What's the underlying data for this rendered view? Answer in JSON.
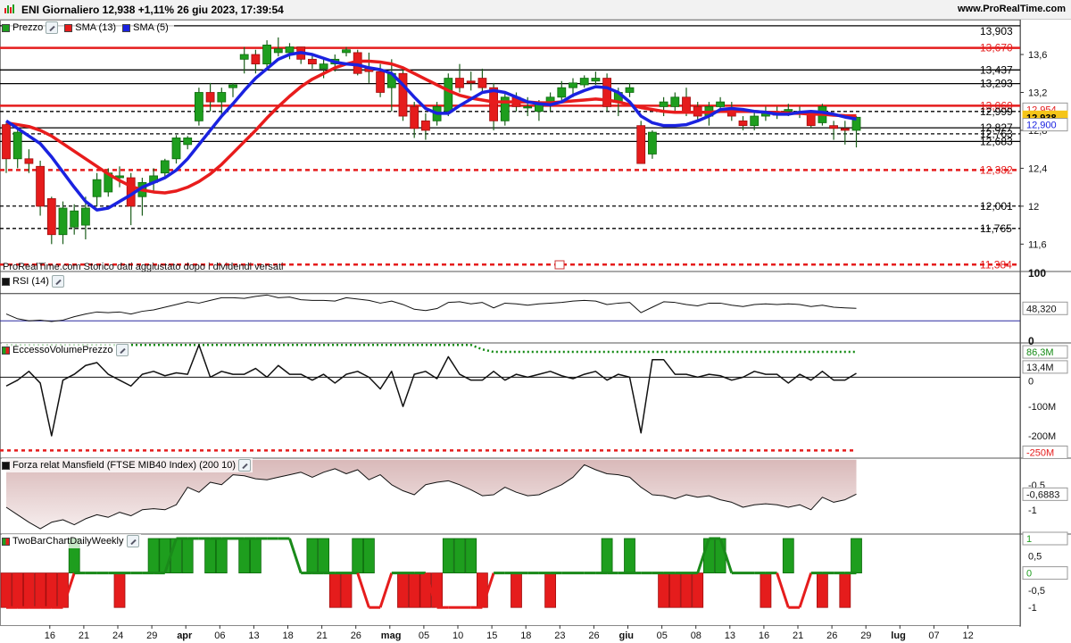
{
  "header": {
    "title": "ENI Giornaliero 12,938 +1,11% 26 giu 2023, 17:39:54",
    "site": "www.ProRealTime.com"
  },
  "note": "ProRealTime.com Storico dati aggiustato dopo i dividendi versati",
  "colors": {
    "up": "#1e9e1e",
    "down": "#e51c1c",
    "sma13": "#e81c1c",
    "sma5": "#1a22e0",
    "resistance_red": "#e51c1c",
    "volume_dotted": "#138a13"
  },
  "price_panel": {
    "label": "Prezzo",
    "sma13_label": "SMA (13)",
    "sma5_label": "SMA (5)",
    "axis_ticks": [
      "13,6",
      "13,2",
      "12,8",
      "12,4",
      "12",
      "11,6"
    ],
    "current_price": "12,938",
    "sma_value": "12,900",
    "sma13_value": "12,954",
    "levels": [
      {
        "value": 13.903,
        "label": "13,903",
        "style": "solid",
        "color": "#000000"
      },
      {
        "value": 13.67,
        "label": "13,670",
        "style": "solid",
        "color": "#e51c1c"
      },
      {
        "value": 13.437,
        "label": "13,437",
        "style": "solid",
        "color": "#000000"
      },
      {
        "value": 13.293,
        "label": "13,293",
        "style": "solid",
        "color": "#000000"
      },
      {
        "value": 13.06,
        "label": "13,060",
        "style": "solid",
        "color": "#e51c1c"
      },
      {
        "value": 12.999,
        "label": "12,999",
        "style": "dashed",
        "color": "#000000"
      },
      {
        "value": 12.827,
        "label": "12,827",
        "style": "solid",
        "color": "#000000"
      },
      {
        "value": 12.763,
        "label": "12,763",
        "style": "dashed",
        "color": "#000000"
      },
      {
        "value": 12.683,
        "label": "12,683",
        "style": "solid",
        "color": "#000000"
      },
      {
        "value": 12.382,
        "label": "12,382",
        "style": "dashed",
        "color": "#e51c1c"
      },
      {
        "value": 12.001,
        "label": "12,001",
        "style": "dashed",
        "color": "#000000"
      },
      {
        "value": 11.765,
        "label": "11,765",
        "style": "dashed",
        "color": "#000000"
      },
      {
        "value": 11.384,
        "label": "11,384",
        "style": "dashed",
        "color": "#e51c1c"
      }
    ]
  },
  "rsi_panel": {
    "label": "RSI (14)",
    "ticks": [
      "100",
      "0"
    ],
    "value": "48,320"
  },
  "volume_panel": {
    "label": "EccessoVolumePrezzo",
    "ticks": [
      "-100M",
      "-200M"
    ],
    "value_upper": "86,3M",
    "value_current": "13,4M",
    "value_zero": "0",
    "value_lower": "-250M"
  },
  "mansfield_panel": {
    "label": "Forza relat Mansfield (FTSE MIB40 Index) (200 10)",
    "ticks": [
      "-0,5",
      "-1"
    ],
    "value": "-0,6883"
  },
  "twobar_panel": {
    "label": "TwoBarChartDailyWeekly",
    "ticks": [
      "0,5",
      "-0,5",
      "-1"
    ],
    "value_top": "1",
    "value_mid": "0"
  },
  "x_axis": {
    "labels": [
      {
        "i": 4,
        "text": "16"
      },
      {
        "i": 7,
        "text": "21"
      },
      {
        "i": 10,
        "text": "24"
      },
      {
        "i": 13,
        "text": "29"
      },
      {
        "i": 16,
        "text": "apr"
      },
      {
        "i": 19,
        "text": "06"
      },
      {
        "i": 22,
        "text": "13"
      },
      {
        "i": 25,
        "text": "18"
      },
      {
        "i": 28,
        "text": "21"
      },
      {
        "i": 31,
        "text": "26"
      },
      {
        "i": 34,
        "text": "mag"
      },
      {
        "i": 37,
        "text": "05"
      },
      {
        "i": 40,
        "text": "10"
      },
      {
        "i": 43,
        "text": "15"
      },
      {
        "i": 46,
        "text": "18"
      },
      {
        "i": 49,
        "text": "23"
      },
      {
        "i": 52,
        "text": "26"
      },
      {
        "i": 55,
        "text": "giu"
      },
      {
        "i": 58,
        "text": "05"
      },
      {
        "i": 61,
        "text": "08"
      },
      {
        "i": 64,
        "text": "13"
      },
      {
        "i": 67,
        "text": "16"
      },
      {
        "i": 70,
        "text": "21"
      },
      {
        "i": 73,
        "text": "26"
      },
      {
        "i": 76,
        "text": "29"
      },
      {
        "i": 79,
        "text": "lug"
      },
      {
        "i": 82,
        "text": "07"
      },
      {
        "i": 85,
        "text": "12"
      }
    ]
  },
  "chart_data": {
    "type": "candlestick",
    "candles_ohlc": [
      [
        12.86,
        12.88,
        12.35,
        12.5
      ],
      [
        12.5,
        12.82,
        12.4,
        12.78
      ],
      [
        12.5,
        12.6,
        12.35,
        12.45
      ],
      [
        12.42,
        12.48,
        11.9,
        12.0
      ],
      [
        12.08,
        12.1,
        11.6,
        11.7
      ],
      [
        11.7,
        12.05,
        11.6,
        11.98
      ],
      [
        11.78,
        12.02,
        11.7,
        11.95
      ],
      [
        11.8,
        12.1,
        11.65,
        11.98
      ],
      [
        12.1,
        12.35,
        12.0,
        12.28
      ],
      [
        12.15,
        12.4,
        12.1,
        12.35
      ],
      [
        12.3,
        12.42,
        12.2,
        12.32
      ],
      [
        12.3,
        12.35,
        11.8,
        12.0
      ],
      [
        12.1,
        12.3,
        11.9,
        12.25
      ],
      [
        12.25,
        12.4,
        12.15,
        12.32
      ],
      [
        12.35,
        12.5,
        12.3,
        12.48
      ],
      [
        12.5,
        12.75,
        12.45,
        12.72
      ],
      [
        12.65,
        12.74,
        12.6,
        12.72
      ],
      [
        12.9,
        13.25,
        12.85,
        13.2
      ],
      [
        13.2,
        13.3,
        13.0,
        13.1
      ],
      [
        13.1,
        13.25,
        12.95,
        13.2
      ],
      [
        13.25,
        13.3,
        13.15,
        13.28
      ],
      [
        13.55,
        13.68,
        13.4,
        13.6
      ],
      [
        13.6,
        13.65,
        13.4,
        13.5
      ],
      [
        13.5,
        13.75,
        13.45,
        13.7
      ],
      [
        13.62,
        13.78,
        13.58,
        13.66
      ],
      [
        13.62,
        13.72,
        13.55,
        13.68
      ],
      [
        13.68,
        13.68,
        13.5,
        13.55
      ],
      [
        13.55,
        13.6,
        13.45,
        13.5
      ],
      [
        13.45,
        13.55,
        13.35,
        13.5
      ],
      [
        13.5,
        13.6,
        13.42,
        13.55
      ],
      [
        13.62,
        13.68,
        13.58,
        13.65
      ],
      [
        13.62,
        13.65,
        13.38,
        13.4
      ],
      [
        13.45,
        13.62,
        13.3,
        13.42
      ],
      [
        13.42,
        13.5,
        13.15,
        13.2
      ],
      [
        13.25,
        13.55,
        13.0,
        13.4
      ],
      [
        13.4,
        13.45,
        12.9,
        12.95
      ],
      [
        13.05,
        13.1,
        12.72,
        12.82
      ],
      [
        12.9,
        12.98,
        12.7,
        12.8
      ],
      [
        12.9,
        13.1,
        12.85,
        13.05
      ],
      [
        13.0,
        13.4,
        12.95,
        13.35
      ],
      [
        13.35,
        13.5,
        13.2,
        13.25
      ],
      [
        13.32,
        13.42,
        13.22,
        13.3
      ],
      [
        13.35,
        13.45,
        13.2,
        13.25
      ],
      [
        13.25,
        13.3,
        12.8,
        12.9
      ],
      [
        12.9,
        13.2,
        12.85,
        13.15
      ],
      [
        13.15,
        13.2,
        13.0,
        13.05
      ],
      [
        13.05,
        13.15,
        12.95,
        13.05
      ],
      [
        13.0,
        13.12,
        12.9,
        13.1
      ],
      [
        13.1,
        13.2,
        13.0,
        13.15
      ],
      [
        13.15,
        13.32,
        13.1,
        13.25
      ],
      [
        13.25,
        13.35,
        13.15,
        13.3
      ],
      [
        13.28,
        13.38,
        13.25,
        13.35
      ],
      [
        13.32,
        13.42,
        13.28,
        13.35
      ],
      [
        13.35,
        13.4,
        13.0,
        13.05
      ],
      [
        13.1,
        13.25,
        12.95,
        13.2
      ],
      [
        13.2,
        13.3,
        13.15,
        13.25
      ],
      [
        12.85,
        12.9,
        12.45,
        12.45
      ],
      [
        12.55,
        12.8,
        12.5,
        12.78
      ],
      [
        13.05,
        13.15,
        12.95,
        13.1
      ],
      [
        13.05,
        13.2,
        13.0,
        13.15
      ],
      [
        13.15,
        13.25,
        12.95,
        13.0
      ],
      [
        13.05,
        13.1,
        12.9,
        12.95
      ],
      [
        12.95,
        13.1,
        12.85,
        13.05
      ],
      [
        13.05,
        13.15,
        13.0,
        13.1
      ],
      [
        13.0,
        13.1,
        12.9,
        12.95
      ],
      [
        12.9,
        12.95,
        12.8,
        12.85
      ],
      [
        12.85,
        13.0,
        12.8,
        12.95
      ],
      [
        12.95,
        13.05,
        12.9,
        13.0
      ],
      [
        12.98,
        13.05,
        12.92,
        12.96
      ],
      [
        13.0,
        13.08,
        12.95,
        13.02
      ],
      [
        12.98,
        13.05,
        12.93,
        13.0
      ],
      [
        12.98,
        13.0,
        12.82,
        12.85
      ],
      [
        12.88,
        13.08,
        12.85,
        13.05
      ],
      [
        12.85,
        12.9,
        12.7,
        12.82
      ],
      [
        12.82,
        12.9,
        12.65,
        12.8
      ],
      [
        12.8,
        12.95,
        12.62,
        12.938
      ]
    ],
    "sma5": [
      12.9,
      12.82,
      12.74,
      12.66,
      12.52,
      12.36,
      12.2,
      12.05,
      11.96,
      11.98,
      12.05,
      12.12,
      12.2,
      12.25,
      12.3,
      12.38,
      12.5,
      12.65,
      12.8,
      12.95,
      13.08,
      13.22,
      13.35,
      13.45,
      13.55,
      13.6,
      13.62,
      13.6,
      13.56,
      13.52,
      13.5,
      13.49,
      13.46,
      13.44,
      13.4,
      13.28,
      13.15,
      13.03,
      12.98,
      12.98,
      13.06,
      13.13,
      13.2,
      13.22,
      13.2,
      13.15,
      13.1,
      13.08,
      13.07,
      13.1,
      13.17,
      13.22,
      13.26,
      13.25,
      13.2,
      13.1,
      12.95,
      12.88,
      12.85,
      12.85,
      12.86,
      12.9,
      12.95,
      13.02,
      13.03,
      13.02,
      13.0,
      12.99,
      12.97,
      12.97,
      12.99,
      13.0,
      12.99,
      12.97,
      12.94,
      12.92
    ],
    "sma13": [
      12.88,
      12.86,
      12.84,
      12.8,
      12.74,
      12.66,
      12.58,
      12.5,
      12.42,
      12.34,
      12.27,
      12.21,
      12.17,
      12.15,
      12.14,
      12.16,
      12.2,
      12.26,
      12.34,
      12.44,
      12.56,
      12.68,
      12.8,
      12.93,
      13.05,
      13.16,
      13.26,
      13.34,
      13.4,
      13.46,
      13.5,
      13.53,
      13.53,
      13.52,
      13.5,
      13.46,
      13.4,
      13.34,
      13.28,
      13.22,
      13.17,
      13.14,
      13.12,
      13.1,
      13.1,
      13.1,
      13.1,
      13.09,
      13.09,
      13.1,
      13.11,
      13.12,
      13.13,
      13.12,
      13.1,
      13.07,
      13.04,
      13.02,
      13.0,
      12.99,
      12.99,
      12.99,
      12.99,
      13.0,
      13.0,
      13.0,
      13.0,
      12.99,
      12.99,
      12.98,
      12.98,
      12.97,
      12.97,
      12.96,
      12.955,
      12.954
    ],
    "rsi": [
      40,
      33,
      30,
      31,
      29,
      31,
      36,
      40,
      43,
      42,
      43,
      40,
      44,
      46,
      50,
      54,
      58,
      56,
      60,
      64,
      64,
      63,
      66,
      68,
      64,
      65,
      61,
      60,
      60,
      59,
      64,
      62,
      60,
      56,
      59,
      54,
      47,
      45,
      48,
      57,
      58,
      55,
      57,
      49,
      56,
      55,
      53,
      55,
      56,
      57,
      59,
      60,
      59,
      54,
      56,
      57,
      42,
      50,
      58,
      57,
      54,
      52,
      56,
      56,
      53,
      51,
      54,
      55,
      54,
      55,
      54,
      51,
      53,
      50,
      49,
      48.32
    ],
    "excess_volume_m": [
      -30,
      -10,
      20,
      -20,
      -200,
      -10,
      10,
      40,
      50,
      10,
      -10,
      -30,
      10,
      20,
      5,
      15,
      10,
      110,
      0,
      20,
      10,
      10,
      30,
      0,
      40,
      10,
      10,
      -10,
      10,
      -20,
      10,
      20,
      0,
      -40,
      20,
      -100,
      10,
      20,
      -5,
      70,
      10,
      -10,
      -10,
      20,
      -10,
      10,
      0,
      10,
      20,
      5,
      -5,
      10,
      20,
      -10,
      10,
      0,
      -190,
      60,
      60,
      10,
      10,
      0,
      10,
      5,
      -10,
      0,
      20,
      10,
      10,
      -20,
      10,
      -10,
      20,
      -10,
      -10,
      13.4
    ],
    "excess_volume_upper_m": [
      86.3
    ],
    "mansfield": [
      -0.95,
      -1.1,
      -1.25,
      -1.38,
      -1.25,
      -1.2,
      -1.3,
      -1.18,
      -1.1,
      -1.15,
      -1.05,
      -1.12,
      -1.0,
      -0.98,
      -1.0,
      -0.9,
      -0.55,
      -0.65,
      -0.45,
      -0.5,
      -0.3,
      -0.32,
      -0.38,
      -0.4,
      -0.35,
      -0.3,
      -0.25,
      -0.35,
      -0.25,
      -0.18,
      -0.28,
      -0.2,
      -0.4,
      -0.3,
      -0.5,
      -0.62,
      -0.7,
      -0.5,
      -0.45,
      -0.42,
      -0.5,
      -0.6,
      -0.72,
      -0.7,
      -0.55,
      -0.65,
      -0.72,
      -0.7,
      -0.6,
      -0.5,
      -0.35,
      -0.1,
      -0.2,
      -0.28,
      -0.3,
      -0.35,
      -0.55,
      -0.7,
      -0.72,
      -0.78,
      -0.7,
      -0.75,
      -0.72,
      -0.8,
      -0.85,
      -0.95,
      -0.9,
      -0.88,
      -0.9,
      -0.95,
      -0.9,
      -1.0,
      -0.75,
      -0.85,
      -0.8,
      -0.6883
    ],
    "twobar_signal": [
      -1,
      -1,
      -1,
      -1,
      -1,
      -1,
      0,
      0,
      0,
      0,
      0,
      0,
      0,
      0,
      0,
      1,
      1,
      1,
      1,
      1,
      1,
      1,
      1,
      1,
      1,
      1,
      0,
      0,
      0,
      0,
      0,
      0,
      -1,
      -1,
      0,
      0,
      0,
      0,
      -1,
      -1,
      -1,
      -1,
      -1,
      0,
      0,
      0,
      0,
      0,
      0,
      0,
      0,
      0,
      0,
      0,
      0,
      0,
      0,
      0,
      0,
      0,
      0,
      0,
      1,
      1,
      0,
      0,
      0,
      0,
      0,
      -1,
      -1,
      0,
      0,
      0,
      0,
      0,
      0,
      0,
      0,
      0,
      0,
      0,
      0,
      0,
      0,
      0,
      0
    ],
    "twobar_bars": [
      -1,
      -1,
      -1,
      -1,
      -1,
      -1,
      1,
      0,
      0,
      0,
      -1,
      0,
      0,
      1,
      1,
      1,
      1,
      0,
      1,
      1,
      0,
      1,
      1,
      0,
      0,
      0,
      0,
      1,
      1,
      -1,
      -1,
      1,
      1,
      0,
      0,
      -1,
      -1,
      -1,
      -1,
      1,
      1,
      1,
      -1,
      0,
      0,
      -1,
      0,
      0,
      -1,
      0,
      0,
      0,
      0,
      1,
      0,
      1,
      0,
      0,
      -1,
      -1,
      -1,
      -1,
      1,
      1,
      0,
      0,
      0,
      -1,
      0,
      1,
      0,
      0,
      -1,
      0,
      -1,
      1
    ]
  }
}
